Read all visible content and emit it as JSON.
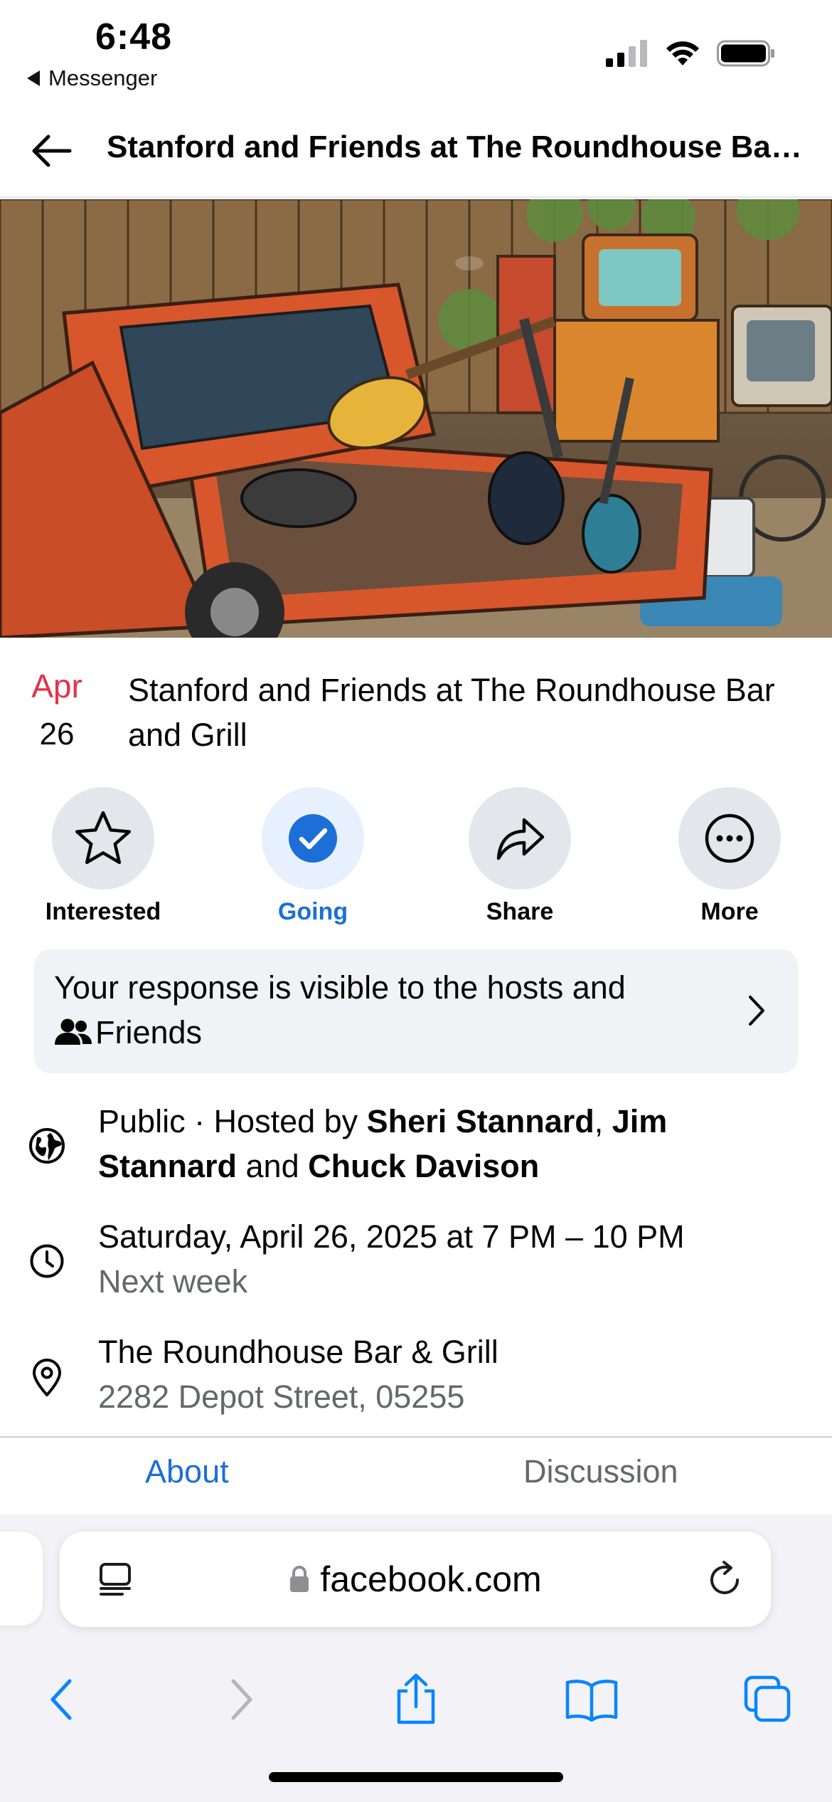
{
  "status_bar": {
    "time": "6:48",
    "back_app": "Messenger",
    "signal_icon": "cellular-signal-icon",
    "wifi_icon": "wifi-icon",
    "battery_icon": "battery-icon"
  },
  "header": {
    "back_icon": "arrow-left-icon",
    "title": "Stanford and Friends at The Roundhouse Bar and Grill"
  },
  "event": {
    "date_month": "Apr",
    "date_day": "26",
    "title": "Stanford and Friends at The Roundhouse Bar and Grill"
  },
  "actions": [
    {
      "label": "Interested",
      "icon": "star-icon"
    },
    {
      "label": "Going",
      "icon": "check-circle-icon",
      "selected": true
    },
    {
      "label": "Share",
      "icon": "share-arrow-icon"
    },
    {
      "label": "More",
      "icon": "more-dots-icon"
    }
  ],
  "notice": {
    "text_line1": "Your response is visible to the hosts and",
    "text_line2": "Friends",
    "icon": "friends-icon",
    "chevron_icon": "chevron-right-icon"
  },
  "details": {
    "privacy": {
      "icon": "globe-icon",
      "prefix": "Public · Hosted by ",
      "host1": "Sheri Stannard",
      "sep1": ", ",
      "host2": "Jim Stannard",
      "sep2": " and ",
      "host3": "Chuck Davison"
    },
    "time": {
      "icon": "clock-icon",
      "main": "Saturday, April 26, 2025 at 7 PM – 10 PM",
      "sub": "Next week"
    },
    "location": {
      "icon": "location-pin-icon",
      "main": "The Roundhouse Bar & Grill",
      "sub": "2282 Depot Street, 05255"
    }
  },
  "tabs": [
    {
      "label": "About",
      "active": true
    },
    {
      "label": "Discussion",
      "active": false
    }
  ],
  "browser": {
    "url": "facebook.com",
    "lock_icon": "lock-icon",
    "reader_icon": "page-menu-icon",
    "reload_icon": "reload-icon",
    "toolbar": [
      "back-icon",
      "forward-icon",
      "share-icon",
      "bookmarks-icon",
      "tabs-icon"
    ]
  },
  "colors": {
    "accent_blue": "#1b6fd6",
    "date_red": "#e4324b",
    "secondary_text": "#65676b",
    "button_gray": "#e4e6eb",
    "safari_blue": "#0a84ff"
  }
}
